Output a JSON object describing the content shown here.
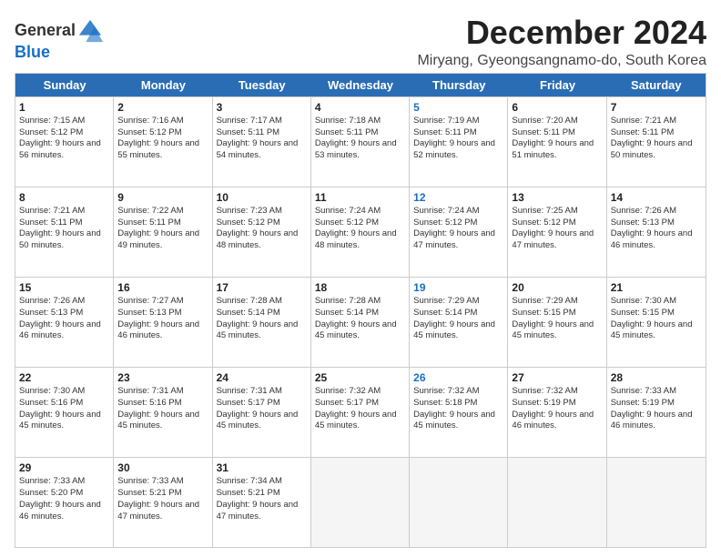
{
  "logo": {
    "line1": "General",
    "line2": "Blue"
  },
  "title": "December 2024",
  "location": "Miryang, Gyeongsangnamo-do, South Korea",
  "days_of_week": [
    "Sunday",
    "Monday",
    "Tuesday",
    "Wednesday",
    "Thursday",
    "Friday",
    "Saturday"
  ],
  "weeks": [
    [
      {
        "day": 1,
        "sunrise": "7:15 AM",
        "sunset": "5:12 PM",
        "daylight": "9 hours and 56 minutes."
      },
      {
        "day": 2,
        "sunrise": "7:16 AM",
        "sunset": "5:12 PM",
        "daylight": "9 hours and 55 minutes."
      },
      {
        "day": 3,
        "sunrise": "7:17 AM",
        "sunset": "5:11 PM",
        "daylight": "9 hours and 54 minutes."
      },
      {
        "day": 4,
        "sunrise": "7:18 AM",
        "sunset": "5:11 PM",
        "daylight": "9 hours and 53 minutes."
      },
      {
        "day": 5,
        "sunrise": "7:19 AM",
        "sunset": "5:11 PM",
        "daylight": "9 hours and 52 minutes.",
        "isThursday": true
      },
      {
        "day": 6,
        "sunrise": "7:20 AM",
        "sunset": "5:11 PM",
        "daylight": "9 hours and 51 minutes."
      },
      {
        "day": 7,
        "sunrise": "7:21 AM",
        "sunset": "5:11 PM",
        "daylight": "9 hours and 50 minutes."
      }
    ],
    [
      {
        "day": 8,
        "sunrise": "7:21 AM",
        "sunset": "5:11 PM",
        "daylight": "9 hours and 50 minutes."
      },
      {
        "day": 9,
        "sunrise": "7:22 AM",
        "sunset": "5:11 PM",
        "daylight": "9 hours and 49 minutes."
      },
      {
        "day": 10,
        "sunrise": "7:23 AM",
        "sunset": "5:12 PM",
        "daylight": "9 hours and 48 minutes."
      },
      {
        "day": 11,
        "sunrise": "7:24 AM",
        "sunset": "5:12 PM",
        "daylight": "9 hours and 48 minutes."
      },
      {
        "day": 12,
        "sunrise": "7:24 AM",
        "sunset": "5:12 PM",
        "daylight": "9 hours and 47 minutes.",
        "isThursday": true
      },
      {
        "day": 13,
        "sunrise": "7:25 AM",
        "sunset": "5:12 PM",
        "daylight": "9 hours and 47 minutes."
      },
      {
        "day": 14,
        "sunrise": "7:26 AM",
        "sunset": "5:13 PM",
        "daylight": "9 hours and 46 minutes."
      }
    ],
    [
      {
        "day": 15,
        "sunrise": "7:26 AM",
        "sunset": "5:13 PM",
        "daylight": "9 hours and 46 minutes."
      },
      {
        "day": 16,
        "sunrise": "7:27 AM",
        "sunset": "5:13 PM",
        "daylight": "9 hours and 46 minutes."
      },
      {
        "day": 17,
        "sunrise": "7:28 AM",
        "sunset": "5:14 PM",
        "daylight": "9 hours and 45 minutes."
      },
      {
        "day": 18,
        "sunrise": "7:28 AM",
        "sunset": "5:14 PM",
        "daylight": "9 hours and 45 minutes."
      },
      {
        "day": 19,
        "sunrise": "7:29 AM",
        "sunset": "5:14 PM",
        "daylight": "9 hours and 45 minutes.",
        "isThursday": true
      },
      {
        "day": 20,
        "sunrise": "7:29 AM",
        "sunset": "5:15 PM",
        "daylight": "9 hours and 45 minutes."
      },
      {
        "day": 21,
        "sunrise": "7:30 AM",
        "sunset": "5:15 PM",
        "daylight": "9 hours and 45 minutes."
      }
    ],
    [
      {
        "day": 22,
        "sunrise": "7:30 AM",
        "sunset": "5:16 PM",
        "daylight": "9 hours and 45 minutes."
      },
      {
        "day": 23,
        "sunrise": "7:31 AM",
        "sunset": "5:16 PM",
        "daylight": "9 hours and 45 minutes."
      },
      {
        "day": 24,
        "sunrise": "7:31 AM",
        "sunset": "5:17 PM",
        "daylight": "9 hours and 45 minutes."
      },
      {
        "day": 25,
        "sunrise": "7:32 AM",
        "sunset": "5:17 PM",
        "daylight": "9 hours and 45 minutes."
      },
      {
        "day": 26,
        "sunrise": "7:32 AM",
        "sunset": "5:18 PM",
        "daylight": "9 hours and 45 minutes.",
        "isThursday": true
      },
      {
        "day": 27,
        "sunrise": "7:32 AM",
        "sunset": "5:19 PM",
        "daylight": "9 hours and 46 minutes."
      },
      {
        "day": 28,
        "sunrise": "7:33 AM",
        "sunset": "5:19 PM",
        "daylight": "9 hours and 46 minutes."
      }
    ],
    [
      {
        "day": 29,
        "sunrise": "7:33 AM",
        "sunset": "5:20 PM",
        "daylight": "9 hours and 46 minutes."
      },
      {
        "day": 30,
        "sunrise": "7:33 AM",
        "sunset": "5:21 PM",
        "daylight": "9 hours and 47 minutes."
      },
      {
        "day": 31,
        "sunrise": "7:34 AM",
        "sunset": "5:21 PM",
        "daylight": "9 hours and 47 minutes."
      },
      null,
      null,
      null,
      null
    ]
  ]
}
